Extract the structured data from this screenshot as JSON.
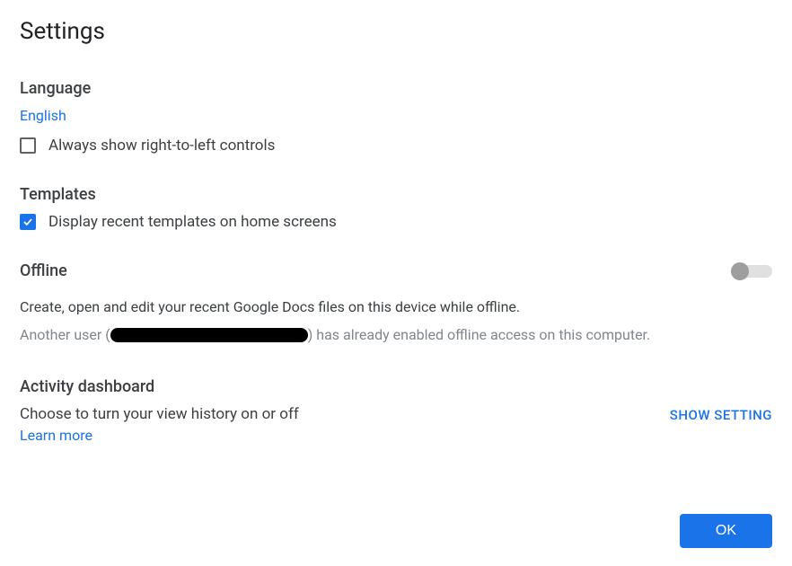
{
  "title": "Settings",
  "language": {
    "heading": "Language",
    "value": "English",
    "rtl_checkbox_label": "Always show right-to-left controls",
    "rtl_checked": false
  },
  "templates": {
    "heading": "Templates",
    "display_recent_label": "Display recent templates on home screens",
    "display_recent_checked": true
  },
  "offline": {
    "heading": "Offline",
    "toggle_on": false,
    "description": "Create, open and edit your recent Google Docs files on this device while offline.",
    "note_prefix": "Another user (",
    "note_suffix": ") has already enabled offline access on this computer."
  },
  "activity": {
    "heading": "Activity dashboard",
    "description": "Choose to turn your view history on or off",
    "learn_more": "Learn more",
    "show_setting": "SHOW SETTING"
  },
  "ok_label": "OK"
}
